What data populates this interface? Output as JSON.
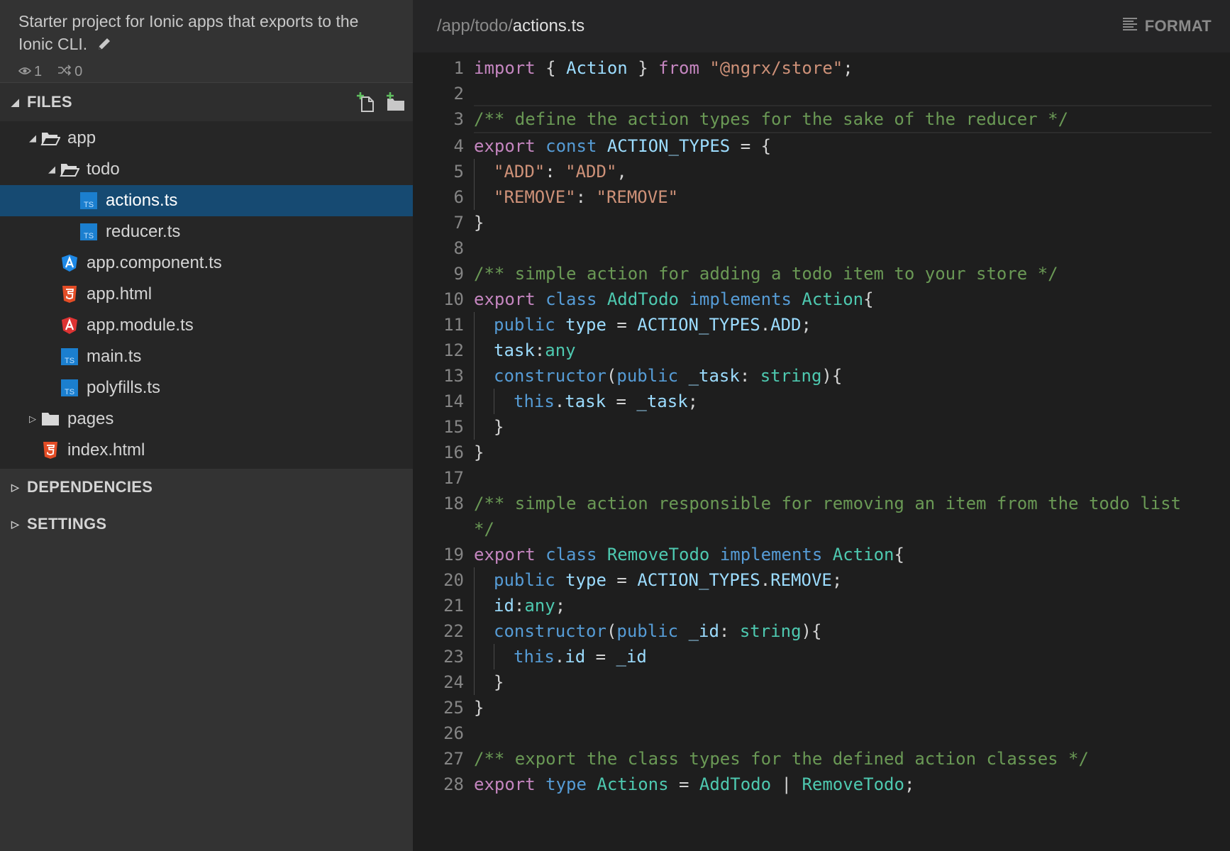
{
  "project": {
    "description": "Starter project for Ionic apps that exports to the Ionic CLI.",
    "watchers": "1",
    "forks": "0"
  },
  "sidebar": {
    "files_label": "FILES",
    "dependencies_label": "DEPENDENCIES",
    "settings_label": "SETTINGS",
    "tree": [
      {
        "label": "app",
        "kind": "folder",
        "expanded": true,
        "depth": 1
      },
      {
        "label": "todo",
        "kind": "folder",
        "expanded": true,
        "depth": 2
      },
      {
        "label": "actions.ts",
        "kind": "ts",
        "depth": 3,
        "selected": true
      },
      {
        "label": "reducer.ts",
        "kind": "ts",
        "depth": 3
      },
      {
        "label": "app.component.ts",
        "kind": "angular-blue",
        "depth": 2
      },
      {
        "label": "app.html",
        "kind": "html",
        "depth": 2
      },
      {
        "label": "app.module.ts",
        "kind": "angular-red",
        "depth": 2
      },
      {
        "label": "main.ts",
        "kind": "ts",
        "depth": 2
      },
      {
        "label": "polyfills.ts",
        "kind": "ts",
        "depth": 2
      },
      {
        "label": "pages",
        "kind": "folder",
        "expanded": false,
        "depth": 1
      },
      {
        "label": "index.html",
        "kind": "html",
        "depth": 1
      }
    ]
  },
  "editor": {
    "path_prefix": "/app/todo/",
    "filename": "actions.ts",
    "format_label": "FORMAT",
    "lines": [
      {
        "n": "1",
        "tokens": [
          [
            "kw",
            "import"
          ],
          [
            "pl",
            " { "
          ],
          [
            "va",
            "Action"
          ],
          [
            "pl",
            " } "
          ],
          [
            "kw",
            "from"
          ],
          [
            "pl",
            " "
          ],
          [
            "st",
            "\"@ngrx/store\""
          ],
          [
            "pl",
            ";"
          ]
        ]
      },
      {
        "n": "2",
        "tokens": []
      },
      {
        "n": "3",
        "active": true,
        "tokens": [
          [
            "co",
            "/** define the action types for the sake of the reducer */"
          ]
        ]
      },
      {
        "n": "4",
        "tokens": [
          [
            "kw",
            "export"
          ],
          [
            "pl",
            " "
          ],
          [
            "sk",
            "const"
          ],
          [
            "pl",
            " "
          ],
          [
            "va",
            "ACTION_TYPES"
          ],
          [
            "pl",
            " = {"
          ]
        ]
      },
      {
        "n": "5",
        "indent": 1,
        "tokens": [
          [
            "st",
            "\"ADD\""
          ],
          [
            "pl",
            ": "
          ],
          [
            "st",
            "\"ADD\""
          ],
          [
            "pl",
            ","
          ]
        ]
      },
      {
        "n": "6",
        "indent": 1,
        "tokens": [
          [
            "st",
            "\"REMOVE\""
          ],
          [
            "pl",
            ": "
          ],
          [
            "st",
            "\"REMOVE\""
          ]
        ]
      },
      {
        "n": "7",
        "tokens": [
          [
            "pl",
            "}"
          ]
        ]
      },
      {
        "n": "8",
        "tokens": []
      },
      {
        "n": "9",
        "tokens": [
          [
            "co",
            "/** simple action for adding a todo item to your store */"
          ]
        ]
      },
      {
        "n": "10",
        "tokens": [
          [
            "kw",
            "export"
          ],
          [
            "pl",
            " "
          ],
          [
            "sk",
            "class"
          ],
          [
            "pl",
            " "
          ],
          [
            "ty",
            "AddTodo"
          ],
          [
            "pl",
            " "
          ],
          [
            "sk",
            "implements"
          ],
          [
            "pl",
            " "
          ],
          [
            "ty",
            "Action"
          ],
          [
            "pl",
            "{"
          ]
        ]
      },
      {
        "n": "11",
        "indent": 1,
        "tokens": [
          [
            "sk",
            "public"
          ],
          [
            "pl",
            " "
          ],
          [
            "va",
            "type"
          ],
          [
            "pl",
            " = "
          ],
          [
            "va",
            "ACTION_TYPES"
          ],
          [
            "pl",
            "."
          ],
          [
            "va",
            "ADD"
          ],
          [
            "pl",
            ";"
          ]
        ]
      },
      {
        "n": "12",
        "indent": 1,
        "tokens": [
          [
            "va",
            "task"
          ],
          [
            "pl",
            ":"
          ],
          [
            "ty",
            "any"
          ]
        ]
      },
      {
        "n": "13",
        "indent": 1,
        "tokens": [
          [
            "sk",
            "constructor"
          ],
          [
            "pl",
            "("
          ],
          [
            "sk",
            "public"
          ],
          [
            "pl",
            " "
          ],
          [
            "va",
            "_task"
          ],
          [
            "pl",
            ": "
          ],
          [
            "ty",
            "string"
          ],
          [
            "pl",
            "){"
          ]
        ]
      },
      {
        "n": "14",
        "indent": 2,
        "tokens": [
          [
            "sk",
            "this"
          ],
          [
            "pl",
            "."
          ],
          [
            "va",
            "task"
          ],
          [
            "pl",
            " = "
          ],
          [
            "va",
            "_task"
          ],
          [
            "pl",
            ";"
          ]
        ]
      },
      {
        "n": "15",
        "indent": 1,
        "tokens": [
          [
            "pl",
            "}"
          ]
        ]
      },
      {
        "n": "16",
        "tokens": [
          [
            "pl",
            "}"
          ]
        ]
      },
      {
        "n": "17",
        "tokens": []
      },
      {
        "n": "18",
        "tokens": [
          [
            "co",
            "/** simple action responsible for removing an item from the todo list */"
          ]
        ]
      },
      {
        "n": "19",
        "tokens": [
          [
            "kw",
            "export"
          ],
          [
            "pl",
            " "
          ],
          [
            "sk",
            "class"
          ],
          [
            "pl",
            " "
          ],
          [
            "ty",
            "RemoveTodo"
          ],
          [
            "pl",
            " "
          ],
          [
            "sk",
            "implements"
          ],
          [
            "pl",
            " "
          ],
          [
            "ty",
            "Action"
          ],
          [
            "pl",
            "{"
          ]
        ]
      },
      {
        "n": "20",
        "indent": 1,
        "tokens": [
          [
            "sk",
            "public"
          ],
          [
            "pl",
            " "
          ],
          [
            "va",
            "type"
          ],
          [
            "pl",
            " = "
          ],
          [
            "va",
            "ACTION_TYPES"
          ],
          [
            "pl",
            "."
          ],
          [
            "va",
            "REMOVE"
          ],
          [
            "pl",
            ";"
          ]
        ]
      },
      {
        "n": "21",
        "indent": 1,
        "tokens": [
          [
            "va",
            "id"
          ],
          [
            "pl",
            ":"
          ],
          [
            "ty",
            "any"
          ],
          [
            "pl",
            ";"
          ]
        ]
      },
      {
        "n": "22",
        "indent": 1,
        "tokens": [
          [
            "sk",
            "constructor"
          ],
          [
            "pl",
            "("
          ],
          [
            "sk",
            "public"
          ],
          [
            "pl",
            " "
          ],
          [
            "va",
            "_id"
          ],
          [
            "pl",
            ": "
          ],
          [
            "ty",
            "string"
          ],
          [
            "pl",
            "){"
          ]
        ]
      },
      {
        "n": "23",
        "indent": 2,
        "tokens": [
          [
            "sk",
            "this"
          ],
          [
            "pl",
            "."
          ],
          [
            "va",
            "id"
          ],
          [
            "pl",
            " = "
          ],
          [
            "va",
            "_id"
          ]
        ]
      },
      {
        "n": "24",
        "indent": 1,
        "tokens": [
          [
            "pl",
            "}"
          ]
        ]
      },
      {
        "n": "25",
        "tokens": [
          [
            "pl",
            "}"
          ]
        ]
      },
      {
        "n": "26",
        "tokens": []
      },
      {
        "n": "27",
        "tokens": [
          [
            "co",
            "/** export the class types for the defined action classes */"
          ]
        ]
      },
      {
        "n": "28",
        "tokens": [
          [
            "kw",
            "export"
          ],
          [
            "pl",
            " "
          ],
          [
            "sk",
            "type"
          ],
          [
            "pl",
            " "
          ],
          [
            "ty",
            "Actions"
          ],
          [
            "pl",
            " = "
          ],
          [
            "ty",
            "AddTodo"
          ],
          [
            "pl",
            " | "
          ],
          [
            "ty",
            "RemoveTodo"
          ],
          [
            "pl",
            ";"
          ]
        ]
      }
    ]
  },
  "colors": {
    "sidebar_bg": "#333333",
    "tree_bg": "#262626",
    "selected_bg": "#164a72",
    "editor_bg": "#1e1e1e",
    "keyword": "#c586c0",
    "string": "#ce9178",
    "comment": "#6a9955",
    "type": "#4ec9b0",
    "storage": "#569cd6",
    "variable": "#9cdcfe"
  }
}
